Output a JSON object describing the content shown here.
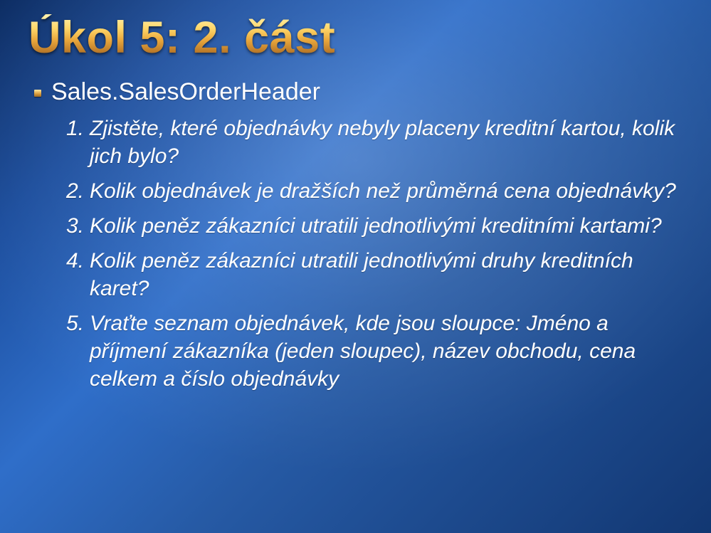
{
  "title": "Úkol 5: 2. část",
  "bullet": "Sales.SalesOrderHeader",
  "items": [
    "Zjistěte, které objednávky nebyly placeny kreditní kartou, kolik jich bylo?",
    "Kolik objednávek je dražších než průměrná cena objednávky?",
    "Kolik peněz zákazníci utratili jednotlivými kreditními kartami?",
    "Kolik peněz zákazníci utratili jednotlivými druhy kreditních karet?",
    "Vraťte seznam objednávek, kde jsou sloupce: Jméno a příjmení zákazníka (jeden sloupec), název obchodu, cena celkem a číslo objednávky"
  ]
}
